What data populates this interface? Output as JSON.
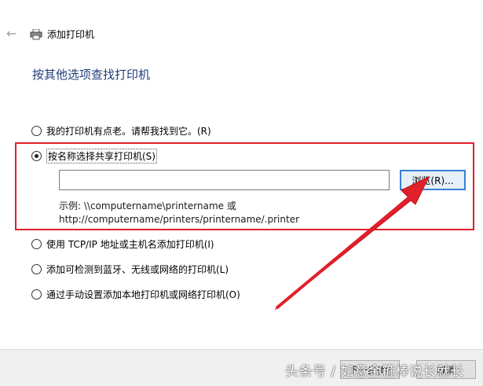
{
  "window": {
    "title": "添加打印机"
  },
  "heading": "按其他选项查找打印机",
  "options": [
    {
      "label": "我的打印机有点老。请帮我找到它。(R)",
      "selected": false
    },
    {
      "label": "按名称选择共享打印机(S)",
      "selected": true
    },
    {
      "label": "使用 TCP/IP 地址或主机名添加打印机(I)",
      "selected": false
    },
    {
      "label": "添加可检测到蓝牙、无线或网络的打印机(L)",
      "selected": false
    },
    {
      "label": "通过手动设置添加本地打印机或网络打印机(O)",
      "selected": false
    }
  ],
  "share_name": {
    "value": "",
    "browse_label": "浏览(R)..."
  },
  "example": {
    "line1": "示例: \\\\computername\\printername 或",
    "line2": "http://computername/printers/printername/.printer"
  },
  "footer": {
    "next_label": "下一步(N)",
    "cancel_label": "取消"
  },
  "watermark": "头条号 / 如意金箍棒说长就长",
  "colors": {
    "heading": "#1f3d7a",
    "highlight_box": "#e0202b",
    "browse_border": "#3c7fd6"
  }
}
